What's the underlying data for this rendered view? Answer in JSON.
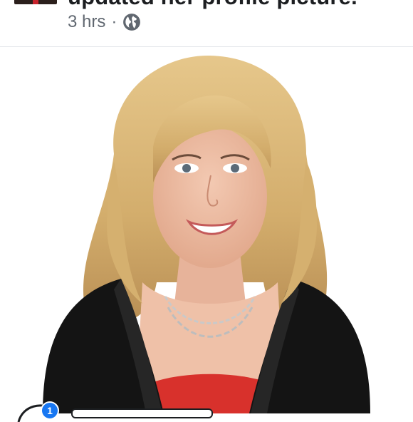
{
  "post": {
    "action_text": "updated her profile picture.",
    "timestamp": "3 hrs",
    "separator": "·",
    "privacy_icon": "globe-icon"
  },
  "bottom": {
    "notification_count": "1"
  },
  "colors": {
    "text_primary": "#1c1e21",
    "text_secondary": "#606770",
    "blazer": "#141414",
    "top": "#d8312c",
    "hair": "#d9b574",
    "badge": "#1877f2"
  }
}
